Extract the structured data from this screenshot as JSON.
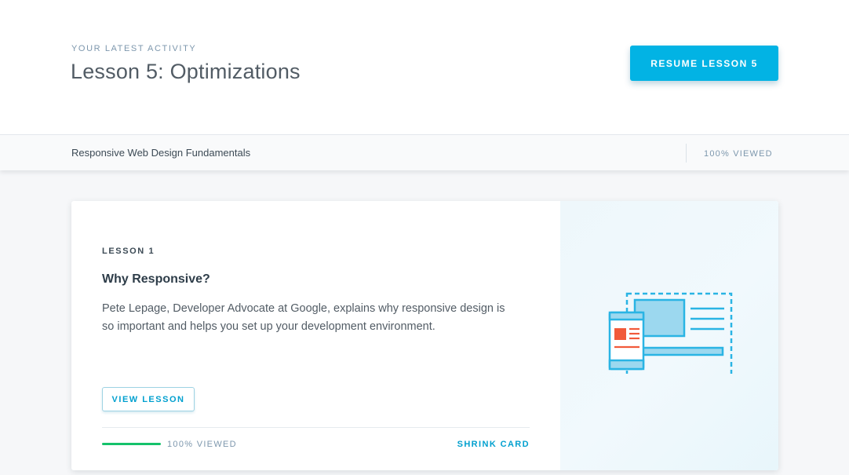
{
  "activity": {
    "eyebrow": "YOUR LATEST ACTIVITY",
    "title": "Lesson 5: Optimizations",
    "resume_label": "RESUME LESSON 5"
  },
  "course_bar": {
    "course_name": "Responsive Web Design Fundamentals",
    "viewed_label": "100% VIEWED",
    "progress_percent": 100
  },
  "lesson_card": {
    "label": "LESSON 1",
    "title": "Why Responsive?",
    "description": "Pete Lepage, Developer Advocate at Google, explains why responsive design is so important and helps you set up your development environment.",
    "view_label": "VIEW LESSON",
    "progress_percent": 100,
    "viewed_label": "100% VIEWED",
    "shrink_label": "SHRINK CARD",
    "illustration_icon": "responsive-devices-icon"
  },
  "colors": {
    "accent": "#02b3e4",
    "link": "#02a0cf",
    "progress": "#15c26b",
    "illustration_blue": "#2ab4e4",
    "illustration_red": "#f15a3a"
  }
}
